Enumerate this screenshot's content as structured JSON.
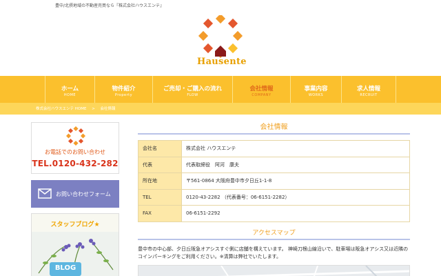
{
  "header": {
    "tagline": "豊中/北摂地域の不動産売買なら『株式会社ハウスエンテ』",
    "logo_text": "Hausente",
    "logo_colors": [
      "#f39c2b",
      "#e4572e",
      "#8b1a1a",
      "#fbc02d"
    ]
  },
  "nav": {
    "items": [
      {
        "jp": "ホーム",
        "en": "HOME",
        "active": false
      },
      {
        "jp": "物件紹介",
        "en": "Property",
        "active": false
      },
      {
        "jp": "ご売却・ご購入の流れ",
        "en": "FLOW",
        "active": false
      },
      {
        "jp": "会社情報",
        "en": "COMPANY",
        "active": true
      },
      {
        "jp": "事業内容",
        "en": "WORKS",
        "active": false
      },
      {
        "jp": "求人情報",
        "en": "RECRUIT",
        "active": false
      }
    ]
  },
  "breadcrumb": {
    "home": "株式会社ハウスエンテ HOME",
    "sep": ">",
    "current": "会社情報"
  },
  "sidebar": {
    "contact_phone_label": "お電話でのお問い合わせ",
    "tel": "TEL.0120-432-282",
    "form_label": "お問い合わせフォーム",
    "blog_label": "スタッフブログ★",
    "blog_badge": "BLOG"
  },
  "main": {
    "title": "会社情報",
    "rows": [
      {
        "k": "会社名",
        "v": "株式会社 ハウスエンテ"
      },
      {
        "k": "代表",
        "v": "代表取締役　阿河　康夫"
      },
      {
        "k": "所在地",
        "v": "〒561-0864 大阪府豊中市夕日丘1-1-8"
      },
      {
        "k": "TEL",
        "v": "0120-43-2282 （代表番号：06-6151-2282）"
      },
      {
        "k": "FAX",
        "v": "06-6151-2292"
      }
    ],
    "access_title": "アクセスマップ",
    "access_note": "豊中市の中心部、夕日丘阪急オアシスすぐ側に店舗を構えています。 神崎刀根山線沿いで、駐車場は阪急オアシス又は近隣のコインパーキングをご利用ください。※清算は弊社でいたします。"
  },
  "colors": {
    "nav_bg": "#fbc02d",
    "crumb_bg": "#fdd65a",
    "active_nav": "#e06a1a",
    "table_key_bg": "#fde8a8",
    "heading": "#f0a020",
    "form_button_bg": "#7c80c2"
  }
}
